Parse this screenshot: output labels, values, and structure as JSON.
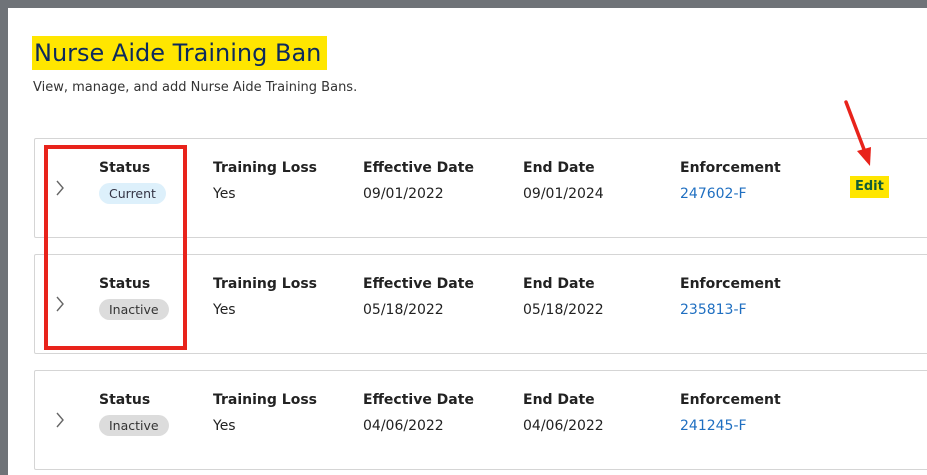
{
  "page": {
    "title": "Nurse Aide Training Ban",
    "subtitle": "View, manage, and add Nurse Aide Training Bans."
  },
  "columns": {
    "status": "Status",
    "training_loss": "Training Loss",
    "effective_date": "Effective Date",
    "end_date": "End Date",
    "enforcement": "Enforcement"
  },
  "bans": [
    {
      "status": "Current",
      "training_loss": "Yes",
      "effective_date": "09/01/2022",
      "end_date": "09/01/2024",
      "enforcement": "247602-F"
    },
    {
      "status": "Inactive",
      "training_loss": "Yes",
      "effective_date": "05/18/2022",
      "end_date": "05/18/2022",
      "enforcement": "235813-F"
    },
    {
      "status": "Inactive",
      "training_loss": "Yes",
      "effective_date": "04/06/2022",
      "end_date": "04/06/2022",
      "enforcement": "241245-F"
    }
  ],
  "actions": {
    "edit_label": "Edit"
  },
  "colors": {
    "highlight": "#ffe600",
    "annotation": "#e8231b",
    "link": "#1f6fc1",
    "badge_current": "#ddf0fb",
    "badge_inactive": "#dcdcdc"
  },
  "icons": {
    "expand": "chevron-right-icon",
    "annotation": "arrow-icon"
  }
}
